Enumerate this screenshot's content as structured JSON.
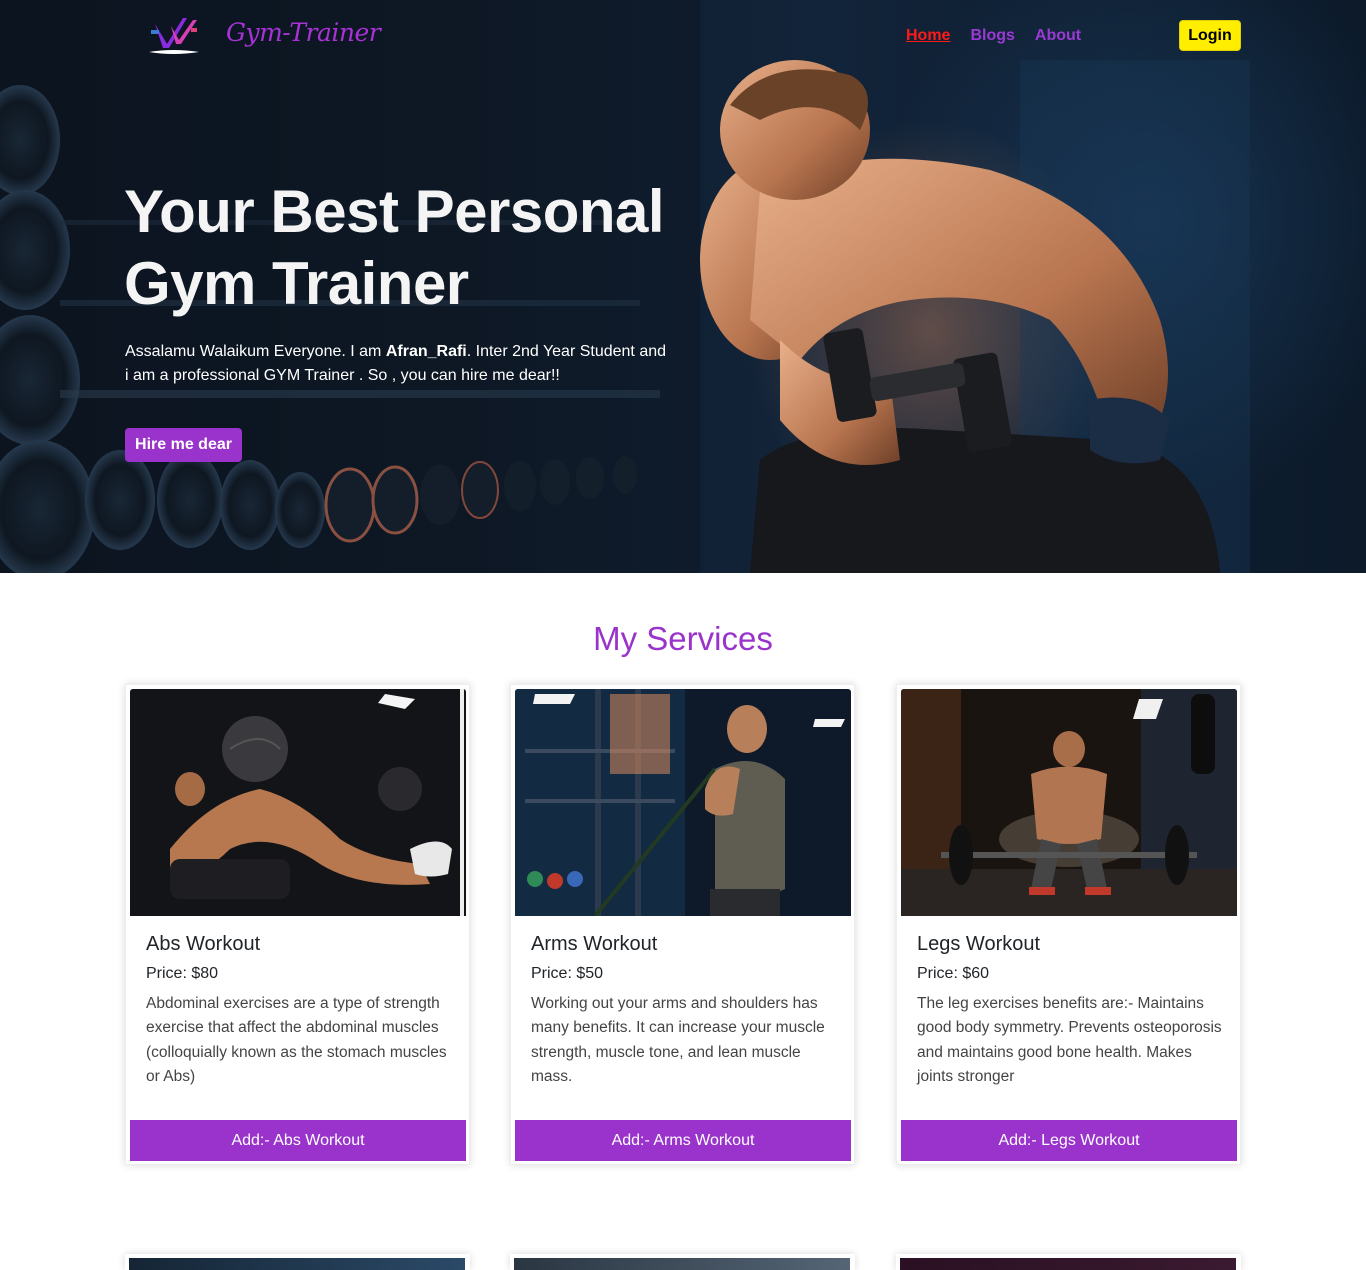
{
  "brand": {
    "name": "Gym-Trainer"
  },
  "nav": {
    "links": [
      {
        "label": "Home",
        "active": true
      },
      {
        "label": "Blogs",
        "active": false
      },
      {
        "label": "About",
        "active": false
      }
    ],
    "login_label": "Login"
  },
  "hero": {
    "title_line1": "Your Best Personal",
    "title_line2": "Gym Trainer",
    "text_before": "Assalamu Walaikum Everyone. I am ",
    "name": "Afran_Rafi",
    "text_after": ". Inter 2nd Year Student and i am a professional GYM Trainer . So , you can hire me dear!!",
    "cta_label": "Hire me dear"
  },
  "services": {
    "heading": "My Services",
    "cards": [
      {
        "title": "Abs Workout",
        "price": "Price: $80",
        "description": "Abdominal exercises are a type of strength exercise that affect the abdominal muscles (colloquially known as the stomach muscles or Abs)",
        "button": "Add:- Abs Workout"
      },
      {
        "title": "Arms Workout",
        "price": "Price: $50",
        "description": "Working out your arms and shoulders has many benefits. It can increase your muscle strength, muscle tone, and lean muscle mass.",
        "button": "Add:- Arms Workout"
      },
      {
        "title": "Legs Workout",
        "price": "Price: $60",
        "description": "The leg exercises benefits are:- Maintains good body symmetry. Prevents osteoporosis and maintains good bone health. Makes joints stronger",
        "button": "Add:- Legs Workout"
      }
    ]
  },
  "colors": {
    "accent": "#9933cc",
    "active_link": "#ff1a1a",
    "login_bg": "#ffee00"
  }
}
